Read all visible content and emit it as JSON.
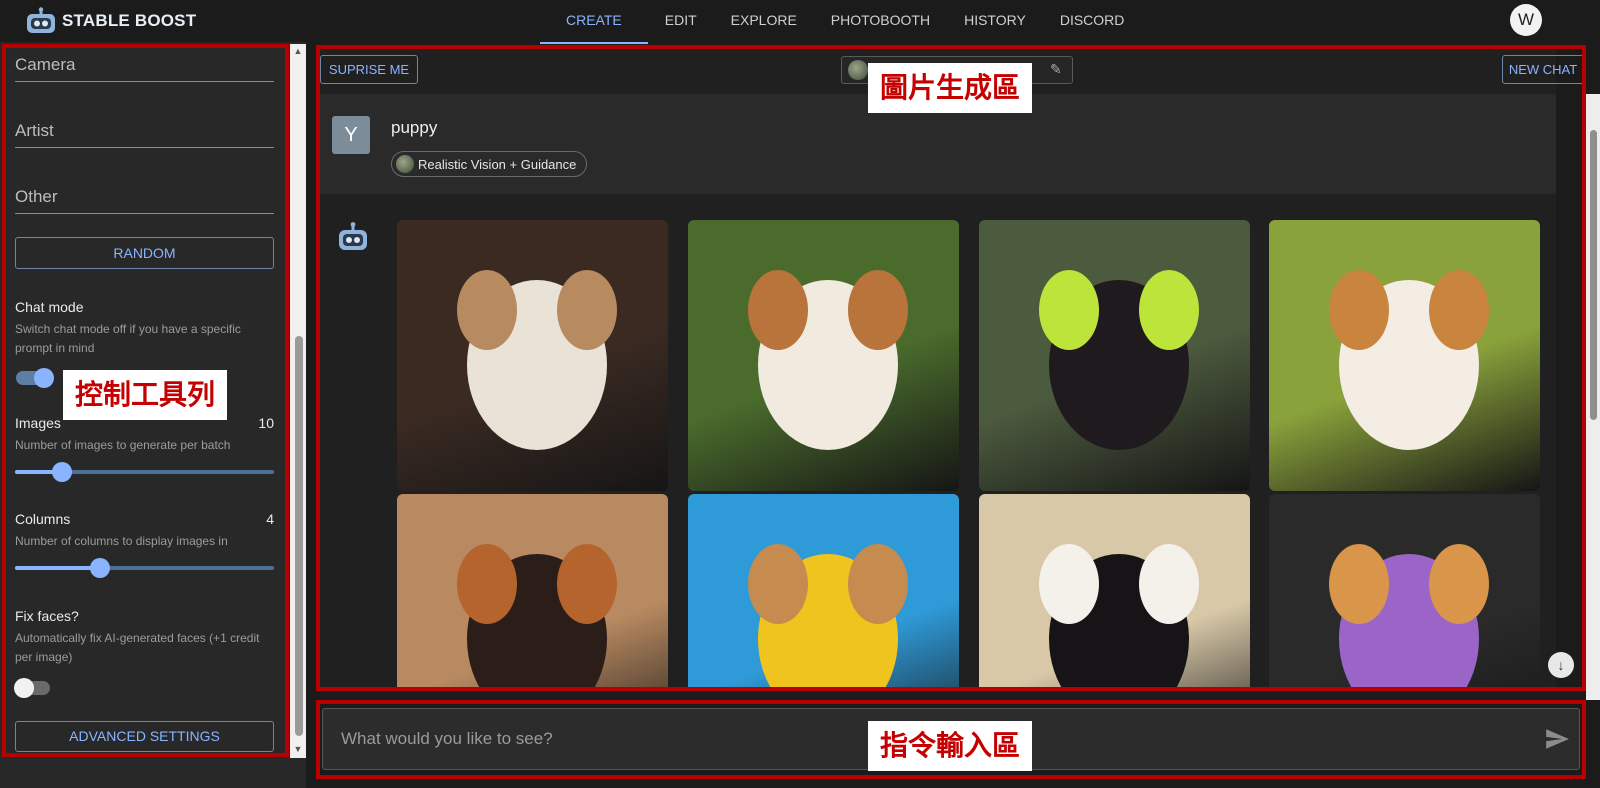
{
  "brand": {
    "name": "STABLE BOOST"
  },
  "nav": {
    "items": [
      {
        "label": "CREATE",
        "active": true
      },
      {
        "label": "EDIT",
        "active": false
      },
      {
        "label": "EXPLORE",
        "active": false
      },
      {
        "label": "PHOTOBOOTH",
        "active": false
      },
      {
        "label": "HISTORY",
        "active": false
      },
      {
        "label": "DISCORD",
        "active": false
      }
    ],
    "user_initial": "W"
  },
  "sidebar": {
    "fields": {
      "camera": "Camera",
      "artist": "Artist",
      "other": "Other"
    },
    "random_button": "RANDOM",
    "chat_mode": {
      "label": "Chat mode",
      "description": "Switch chat mode off if you have a specific prompt in mind",
      "enabled": true
    },
    "images": {
      "label": "Images",
      "value": "10",
      "description": "Number of images to generate per batch",
      "level": 0.18
    },
    "columns": {
      "label": "Columns",
      "value": "4",
      "description": "Number of columns to display images in",
      "level": 0.33
    },
    "fix_faces": {
      "label": "Fix faces?",
      "description": "Automatically fix AI-generated faces (+1 credit per image)",
      "enabled": false
    },
    "advanced_button": "ADVANCED SETTINGS"
  },
  "main": {
    "suprise_button": "SUPRISE ME",
    "new_chat_button": "NEW CHAT",
    "user_message": {
      "avatar_initial": "Y",
      "prompt": "puppy",
      "model_chip": "Realistic Vision + Guidance"
    },
    "images": [
      {
        "alt": "fluffy white puppy on rug",
        "colors": [
          "#3a2a22",
          "#e9e2d6",
          "#b88a60"
        ]
      },
      {
        "alt": "brown and white puppy running on grass",
        "colors": [
          "#4a6b2c",
          "#f0eadf",
          "#b8743a"
        ]
      },
      {
        "alt": "black puppy in green vest running",
        "colors": [
          "#4c5a3e",
          "#1e1a1d",
          "#bde43a"
        ]
      },
      {
        "alt": "tan puppy in yellow flower field",
        "colors": [
          "#8aa23c",
          "#f3ede4",
          "#c9843e"
        ]
      },
      {
        "alt": "woman with dachshund puppy",
        "colors": [
          "#b98a61",
          "#2b1d18",
          "#b4642c"
        ]
      },
      {
        "alt": "puppy with colorful toy",
        "colors": [
          "#2f9ad8",
          "#efc41e",
          "#c58b4f"
        ]
      },
      {
        "alt": "black and white puppy close-up",
        "colors": [
          "#d8c8a8",
          "#171417",
          "#f4f0ea"
        ]
      },
      {
        "alt": "tan puppy on purple blanket",
        "colors": [
          "#2a2a2a",
          "#9a65c6",
          "#d9954a"
        ]
      }
    ]
  },
  "input": {
    "placeholder": "What would you like to see?"
  },
  "annotations": {
    "image_area": "圖片生成區",
    "toolbar": "控制工具列",
    "input_area": "指令輸入區"
  },
  "colors": {
    "accent": "#8ab4ff",
    "annotation_frame": "#b80000",
    "background": "#1b1b1b",
    "panel": "#282828"
  }
}
